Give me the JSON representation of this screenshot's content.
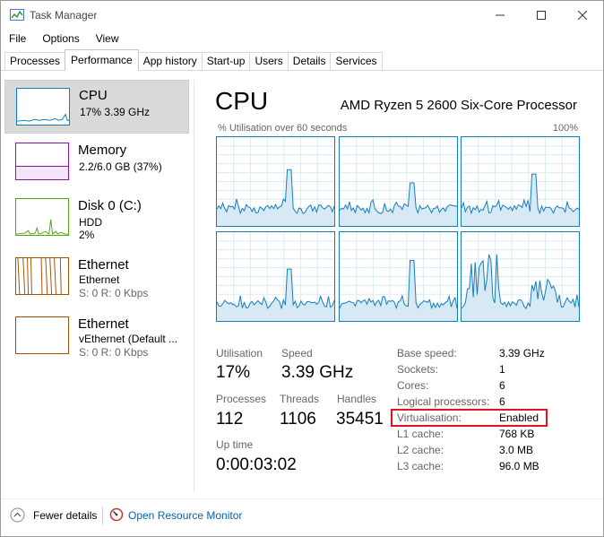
{
  "window": {
    "title": "Task Manager"
  },
  "menu": [
    "File",
    "Options",
    "View"
  ],
  "tabs": [
    {
      "label": "Processes"
    },
    {
      "label": "Performance",
      "active": true
    },
    {
      "label": "App history"
    },
    {
      "label": "Start-up"
    },
    {
      "label": "Users"
    },
    {
      "label": "Details"
    },
    {
      "label": "Services"
    }
  ],
  "sidebar": {
    "items": [
      {
        "name": "CPU",
        "line1": "17% 3.39 GHz",
        "color": "#117dbb",
        "selected": true
      },
      {
        "name": "Memory",
        "line1": "2.2/6.0 GB (37%)",
        "color": "#8b12ae",
        "level": 0.37
      },
      {
        "name": "Disk 0 (C:)",
        "line1": "HDD",
        "line2": "2%",
        "color": "#4da60c"
      },
      {
        "name": "Ethernet",
        "line1": "Ethernet",
        "line2": "S: 0 R: 0 Kbps",
        "color": "#a74f01"
      },
      {
        "name": "Ethernet",
        "line1": "vEthernet (Default ...",
        "line2": "S: 0 R: 0 Kbps",
        "color": "#a74f01"
      }
    ]
  },
  "main": {
    "title": "CPU",
    "model": "AMD Ryzen 5 2600 Six-Core Processor",
    "graph_label": "% Utilisation over 60 seconds",
    "graph_max": "100%",
    "graph_color": "#117dbb",
    "graph_count": 6
  },
  "stats": {
    "utilisation_label": "Utilisation",
    "utilisation_value": "17%",
    "speed_label": "Speed",
    "speed_value": "3.39 GHz",
    "processes_label": "Processes",
    "processes_value": "112",
    "threads_label": "Threads",
    "threads_value": "1106",
    "handles_label": "Handles",
    "handles_value": "35451",
    "uptime_label": "Up time",
    "uptime_value": "0:00:03:02"
  },
  "info": [
    {
      "label": "Base speed:",
      "value": "3.39 GHz"
    },
    {
      "label": "Sockets:",
      "value": "1"
    },
    {
      "label": "Cores:",
      "value": "6"
    },
    {
      "label": "Logical processors:",
      "value": "6"
    },
    {
      "label": "Virtualisation:",
      "value": "Enabled"
    },
    {
      "label": "L1 cache:",
      "value": "768 KB"
    },
    {
      "label": "L2 cache:",
      "value": "3.0 MB"
    },
    {
      "label": "L3 cache:",
      "value": "96.0 MB"
    }
  ],
  "footer": {
    "fewer_details": "Fewer details",
    "resource_monitor": "Open Resource Monitor"
  },
  "annotation": {
    "highlight_color": "#e81123"
  }
}
